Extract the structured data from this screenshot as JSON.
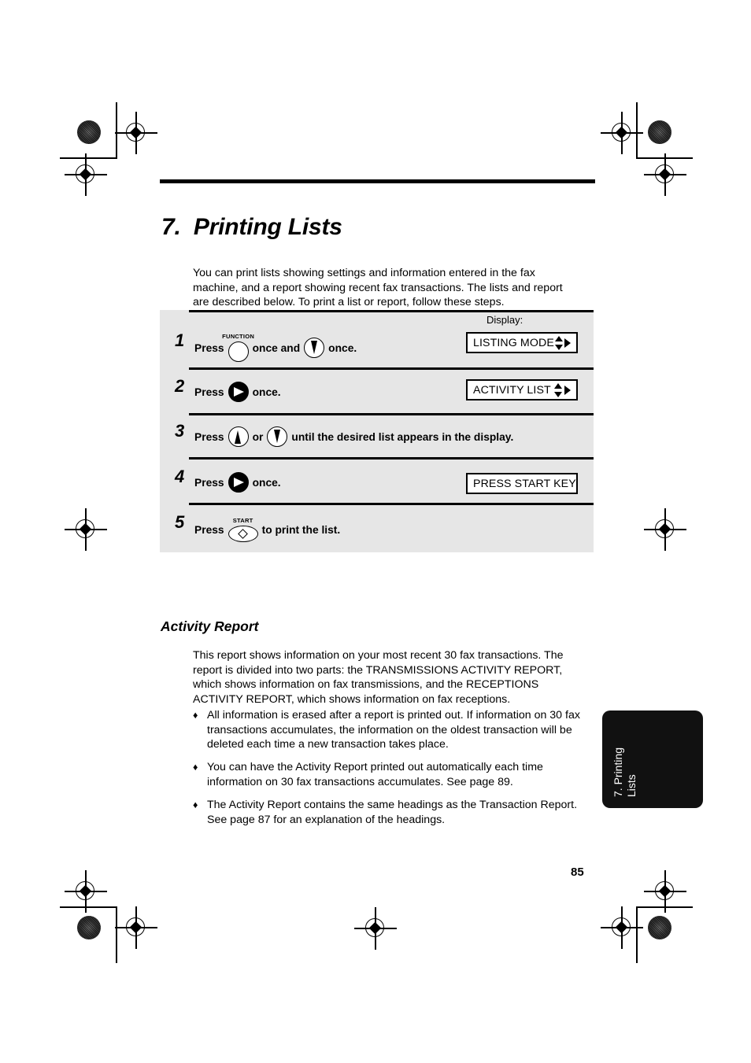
{
  "document": {
    "chapter_title": "7.  Printing Lists",
    "page_number": "85",
    "side_tab": "7. Printing\nLists",
    "intro": "You can print lists showing settings and information entered in the fax machine, and a report showing recent fax transactions. The lists and report are described below. To print a list or report, follow these steps."
  },
  "procedure": {
    "display_label": "Display:",
    "steps": [
      {
        "number": "1",
        "press": "Press",
        "key1_cap": "FUNCTION",
        "mid": "once and",
        "tail": "once.",
        "display": "LISTING MODE",
        "display_arrows": "up-down-right"
      },
      {
        "number": "2",
        "press": "Press",
        "tail": "once.",
        "display": "ACTIVITY LIST",
        "display_arrows": "up-down-right"
      },
      {
        "number": "3",
        "press": "Press",
        "mid": "or",
        "tail": "until the desired list appears in the display."
      },
      {
        "number": "4",
        "press": "Press",
        "tail": "once.",
        "display": "PRESS START KEY"
      },
      {
        "number": "5",
        "press": "Press",
        "key_cap": "START",
        "tail": "to print the list."
      }
    ]
  },
  "activity_report": {
    "heading": "Activity Report",
    "paragraph": "This report shows information on your most recent 30 fax transactions. The report is divided into two parts: the TRANSMISSIONS ACTIVITY REPORT, which shows information on fax transmissions, and the RECEPTIONS ACTIVITY REPORT, which shows information on fax receptions.",
    "bullets": [
      "All information is erased after a report is printed out. If information on 30 fax transactions accumulates, the information on the oldest transaction will be deleted each time a new transaction takes place.",
      "You can have the Activity Report printed out automatically each time information on 30 fax transactions accumulates. See page 89.",
      "The Activity Report contains the same headings as the Transaction Report. See page 87 for an explanation of the headings."
    ],
    "bullet_mark": "♦"
  },
  "colors": {
    "panel_gray": "#e6e6e6",
    "tab_black": "#111111",
    "ink": "#000000"
  }
}
